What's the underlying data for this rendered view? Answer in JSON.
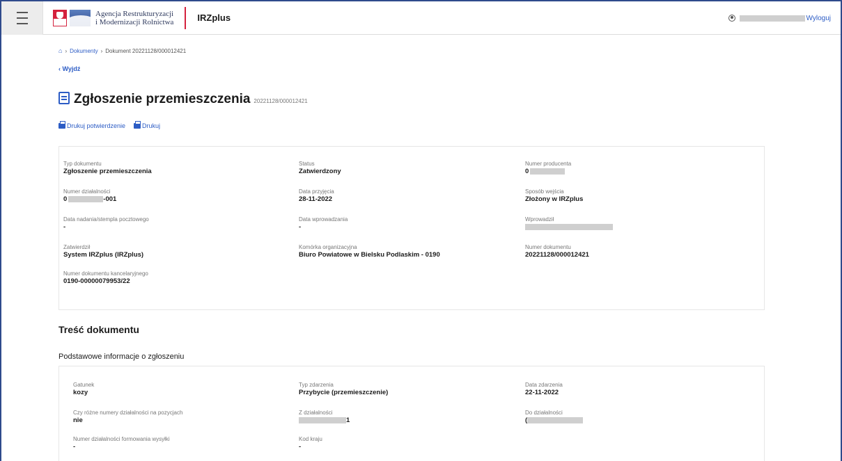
{
  "header": {
    "agency_line1": "Agencja Restrukturyzacji",
    "agency_line2": "i Modernizacji Rolnictwa",
    "app_name": "IRZplus",
    "logout": "Wyloguj"
  },
  "breadcrumb": {
    "items": [
      "Dokumenty",
      "Dokument 20221128/000012421"
    ]
  },
  "back_label": "Wyjdź",
  "page": {
    "title": "Zgłoszenie przemieszczenia",
    "title_number": "20221128/000012421"
  },
  "actions": {
    "print_confirmation": "Drukuj potwierdzenie",
    "print": "Drukuj"
  },
  "details": [
    {
      "label": "Typ dokumentu",
      "value": "Zgłoszenie przemieszczenia"
    },
    {
      "label": "Status",
      "value": "Zatwierdzony"
    },
    {
      "label": "Numer producenta",
      "value": "0"
    },
    {
      "label": "Numer działalności",
      "value": "0",
      "value_suffix": "-001"
    },
    {
      "label": "Data przyjęcia",
      "value": "28-11-2022"
    },
    {
      "label": "Sposób wejścia",
      "value": "Złożony w IRZplus"
    },
    {
      "label": "Data nadania/stempla pocztowego",
      "value": "-"
    },
    {
      "label": "Data wprowadzania",
      "value": "-"
    },
    {
      "label": "Wprowadził",
      "value": ""
    },
    {
      "label": "Zatwierdził",
      "value": "System IRZplus (IRZplus)"
    },
    {
      "label": "Komórka organizacyjna",
      "value": "Biuro Powiatowe w Bielsku Podlaskim - 0190"
    },
    {
      "label": "Numer dokumentu",
      "value": "20221128/000012421"
    },
    {
      "label": "Numer dokumentu kancelaryjnego",
      "value": "0190-00000079953/22"
    }
  ],
  "content_section": {
    "title": "Treść dokumentu",
    "subtitle": "Podstawowe informacje o zgłoszeniu"
  },
  "basic_info": [
    {
      "label": "Gatunek",
      "value": "kozy"
    },
    {
      "label": "Typ zdarzenia",
      "value": "Przybycie (przemieszczenie)"
    },
    {
      "label": "Data zdarzenia",
      "value": "22-11-2022"
    },
    {
      "label": "Czy różne numery działalności na pozycjach",
      "value": "nie"
    },
    {
      "label": "Z działalności",
      "value": "1"
    },
    {
      "label": "Do działalności",
      "value": "("
    },
    {
      "label": "Numer działalności formowania wysyłki",
      "value": "-"
    },
    {
      "label": "Kod kraju",
      "value": "-"
    }
  ]
}
